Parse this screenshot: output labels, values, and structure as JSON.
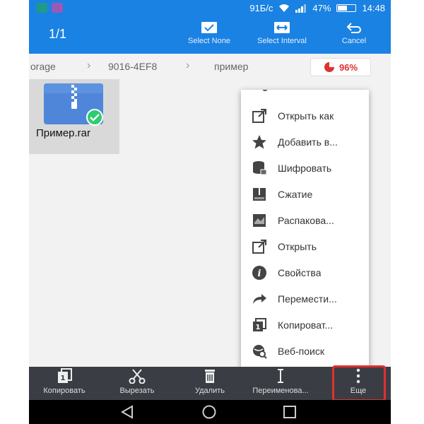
{
  "status_bar": {
    "speed": "91Б/с",
    "battery": "47%",
    "time": "14:48",
    "icons": [
      "wifi-icon",
      "signal-icon",
      "battery-icon"
    ]
  },
  "action_bar": {
    "selection_count": "1/1",
    "select_none": "Select None",
    "select_interval": "Select Interval",
    "cancel": "Cancel"
  },
  "breadcrumb": {
    "items": [
      "orage",
      "9016-4EF8",
      "пример"
    ],
    "storage_used": "96%"
  },
  "file": {
    "name": "Пример.rar",
    "selected": true
  },
  "context_menu": {
    "items": [
      {
        "label": "Открыть как",
        "icon": "open-as-icon"
      },
      {
        "label": "Добавить в...",
        "icon": "star-icon"
      },
      {
        "label": "Шифровать",
        "icon": "encrypt-icon"
      },
      {
        "label": "Сжатие",
        "icon": "compress-icon"
      },
      {
        "label": "Распакова...",
        "icon": "extract-icon"
      },
      {
        "label": "Открыть",
        "icon": "open-icon"
      },
      {
        "label": "Свойства",
        "icon": "info-icon"
      },
      {
        "label": "Перемести...",
        "icon": "move-icon"
      },
      {
        "label": "Копироват...",
        "icon": "copy-icon"
      },
      {
        "label": "Веб-поиск",
        "icon": "web-search-icon"
      }
    ]
  },
  "bottom_bar": {
    "copy": "Копировать",
    "cut": "Вырезать",
    "delete": "Удалить",
    "rename": "Переименова...",
    "more": "Еще"
  },
  "colors": {
    "primary": "#1a82e2",
    "toolbar": "#3a3e44",
    "highlight": "#e03030",
    "badge": "#e0312e"
  }
}
